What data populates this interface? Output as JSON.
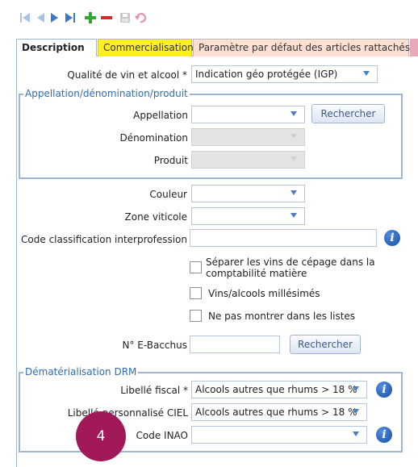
{
  "toolbar": {
    "icons": [
      "first-record-icon",
      "previous-record-icon",
      "next-record-icon",
      "last-record-icon",
      "add-icon",
      "delete-icon",
      "save-icon",
      "undo-icon"
    ]
  },
  "tabs": [
    {
      "label": "Description",
      "state": "active"
    },
    {
      "label": "Commercialisation",
      "color": "#ffee22"
    },
    {
      "label": "Paramètre par défaut des articles rattachés",
      "color": "#fde0d2"
    }
  ],
  "form": {
    "qualite_label": "Qualité de vin et alcool *",
    "qualite_value": "Indication géo protégée (IGP)",
    "appellation_group": {
      "title": "Appellation/dénomination/produit",
      "appellation_label": "Appellation",
      "appellation_value": "",
      "search_button": "Rechercher",
      "denomination_label": "Dénomination",
      "produit_label": "Produit"
    },
    "couleur_label": "Couleur",
    "zone_label": "Zone viticole",
    "code_class_label": "Code classification interprofession",
    "checkboxes": [
      {
        "label_line1": "Séparer les vins de cépage dans la",
        "label_line2": "comptabilité matière",
        "checked": false
      },
      {
        "label": "Vins/alcools millésimés",
        "checked": false
      },
      {
        "label": "Ne pas montrer dans les listes",
        "checked": false
      }
    ],
    "ebacchus_label": "N° E-Bacchus",
    "ebacchus_search": "Rechercher",
    "drm_group": {
      "title": "Dématérialisation DRM",
      "libelle_fiscal_label": "Libellé fiscal *",
      "libelle_fiscal_value": "Alcools autres que rhums > 18 %",
      "libelle_ciel_label": "Libellé personnalisé CIEL",
      "libelle_ciel_value": "Alcools autres que rhums > 18 %",
      "code_inao_label": "Code INAO",
      "code_inao_value": ""
    }
  },
  "callout": {
    "number": "4",
    "color": "#a2195a"
  },
  "colors": {
    "accent": "#2f6cb5",
    "border": "#9fb6d2",
    "info": "#1a4fa8"
  }
}
